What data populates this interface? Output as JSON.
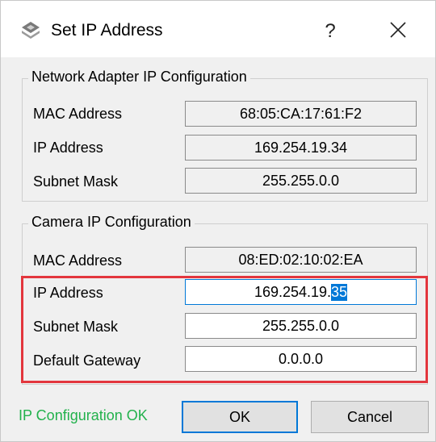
{
  "window": {
    "title": "Set IP Address",
    "help_label": "?",
    "close_icon": "close-icon",
    "app_icon": "camera-app-icon"
  },
  "network_adapter": {
    "group_label": "Network Adapter IP Configuration",
    "mac_label": "MAC Address",
    "mac_value": "68:05:CA:17:61:F2",
    "ip_label": "IP Address",
    "ip_value": "169.254.19.34",
    "subnet_label": "Subnet Mask",
    "subnet_value": "255.255.0.0"
  },
  "camera": {
    "group_label": "Camera IP Configuration",
    "mac_label": "MAC Address",
    "mac_value": "08:ED:02:10:02:EA",
    "ip_label": "IP Address",
    "ip_value_prefix": "169.254.19.",
    "ip_value_selected": "35",
    "subnet_label": "Subnet Mask",
    "subnet_value": "255.255.0.0",
    "gateway_label": "Default Gateway",
    "gateway_value": "0.0.0.0"
  },
  "footer": {
    "status_text": "IP Configuration OK",
    "ok_label": "OK",
    "cancel_label": "Cancel"
  },
  "colors": {
    "status_ok": "#22b14c",
    "highlight": "#e3363d",
    "focus_accent": "#0078d7"
  }
}
